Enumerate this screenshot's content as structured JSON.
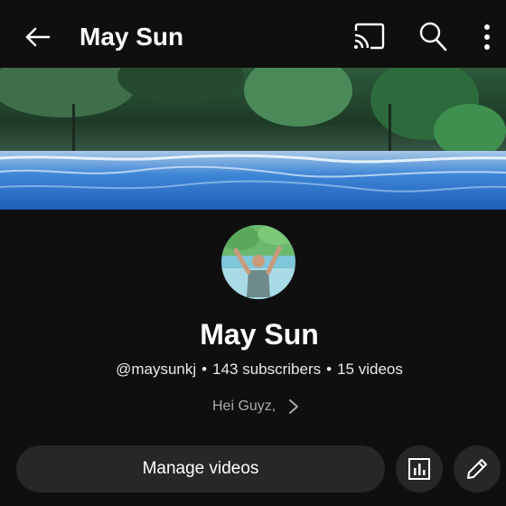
{
  "header": {
    "title": "May Sun",
    "icons": [
      "back-arrow-icon",
      "cast-icon",
      "search-icon",
      "more-vert-icon"
    ]
  },
  "channel": {
    "name": "May Sun",
    "handle": "@maysunkj",
    "subscribers": "143 subscribers",
    "videos": "15 videos",
    "separator": "•",
    "description": "Hei Guyz,"
  },
  "actions": {
    "manage_label": "Manage videos",
    "icons": [
      "analytics-icon",
      "edit-pencil-icon"
    ]
  },
  "colors": {
    "background": "#0f0f0f",
    "button_bg": "#272727",
    "secondary_text": "#aaaaaa"
  }
}
